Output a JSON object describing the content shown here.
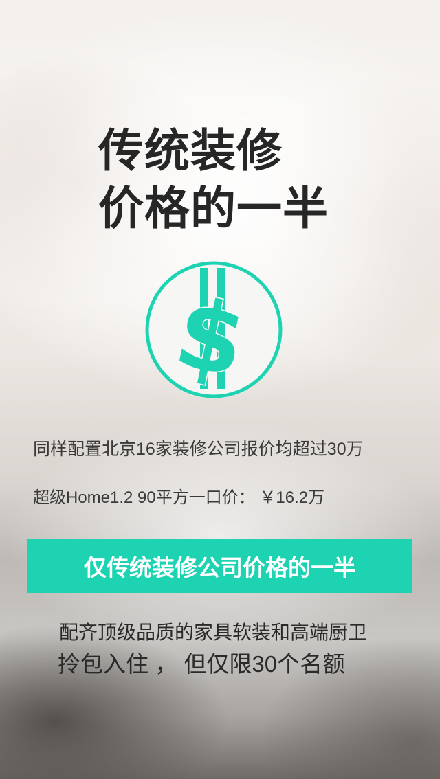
{
  "headline": {
    "line1": "传统装修",
    "line2": "价格的一半"
  },
  "icons": {
    "coin": "dollar-coin-icon"
  },
  "colors": {
    "accent": "#1ed3b2",
    "headline": "#262626",
    "body_text": "#3a3a3a"
  },
  "info": {
    "line1": "同样配置北京16家装修公司报价均超过30万",
    "line2": "超级Home1.2    90平方一口价： ￥16.2万"
  },
  "banner": {
    "label": "仅传统装修公司价格的一半"
  },
  "footer": {
    "line1": "配齐顶级品质的家具软装和高端厨卫",
    "line2": "拎包入住 ， 但仅限30个名额"
  }
}
